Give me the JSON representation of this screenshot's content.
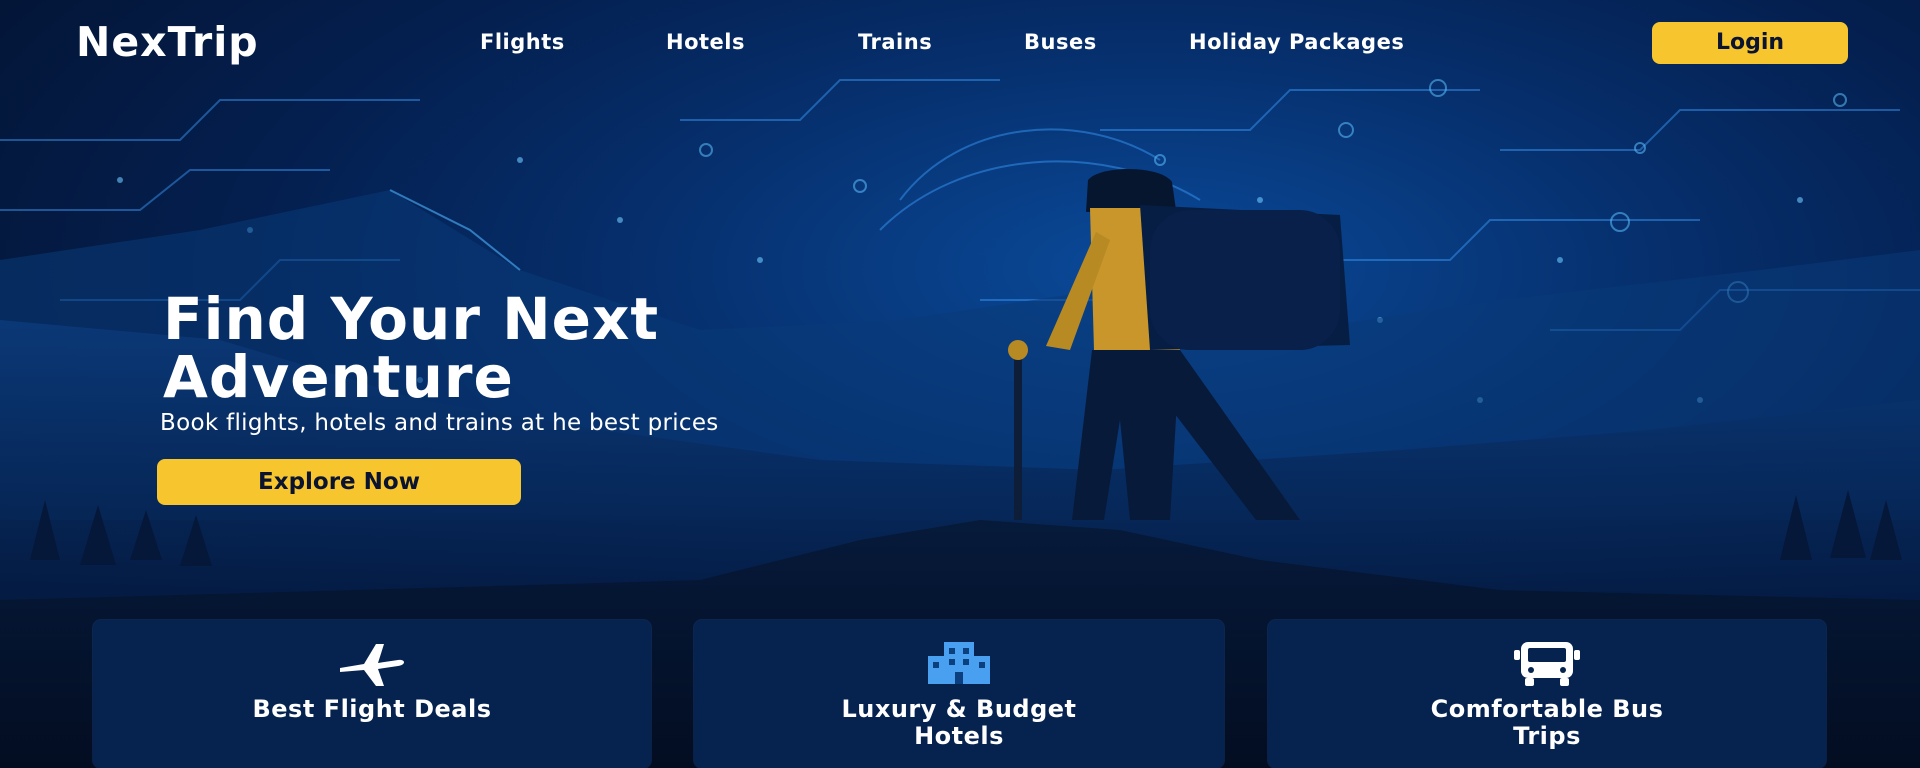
{
  "brand": {
    "logo": "NexTrip"
  },
  "nav": {
    "links": [
      {
        "label": "Flights"
      },
      {
        "label": "Hotels"
      },
      {
        "label": "Trains"
      },
      {
        "label": "Buses"
      },
      {
        "label": "Holiday Packages"
      }
    ],
    "login_label": "Login"
  },
  "hero": {
    "headline_line1": "Find Your Next",
    "headline_line2": "Adventure",
    "subtitle": "Book flights, hotels and trains at he best prices",
    "cta_label": "Explore Now"
  },
  "features": [
    {
      "icon": "airplane-icon",
      "title_line1": "Best Flight Deals",
      "title_line2": ""
    },
    {
      "icon": "hotel-building-icon",
      "title_line1": "Luxury & Budget",
      "title_line2": "Hotels"
    },
    {
      "icon": "bus-icon",
      "title_line1": "Comfortable Bus",
      "title_line2": "Trips"
    }
  ],
  "colors": {
    "accent": "#f7c52e",
    "background": "#041634",
    "card": "#062350",
    "circuit": "#3fa0ff"
  }
}
